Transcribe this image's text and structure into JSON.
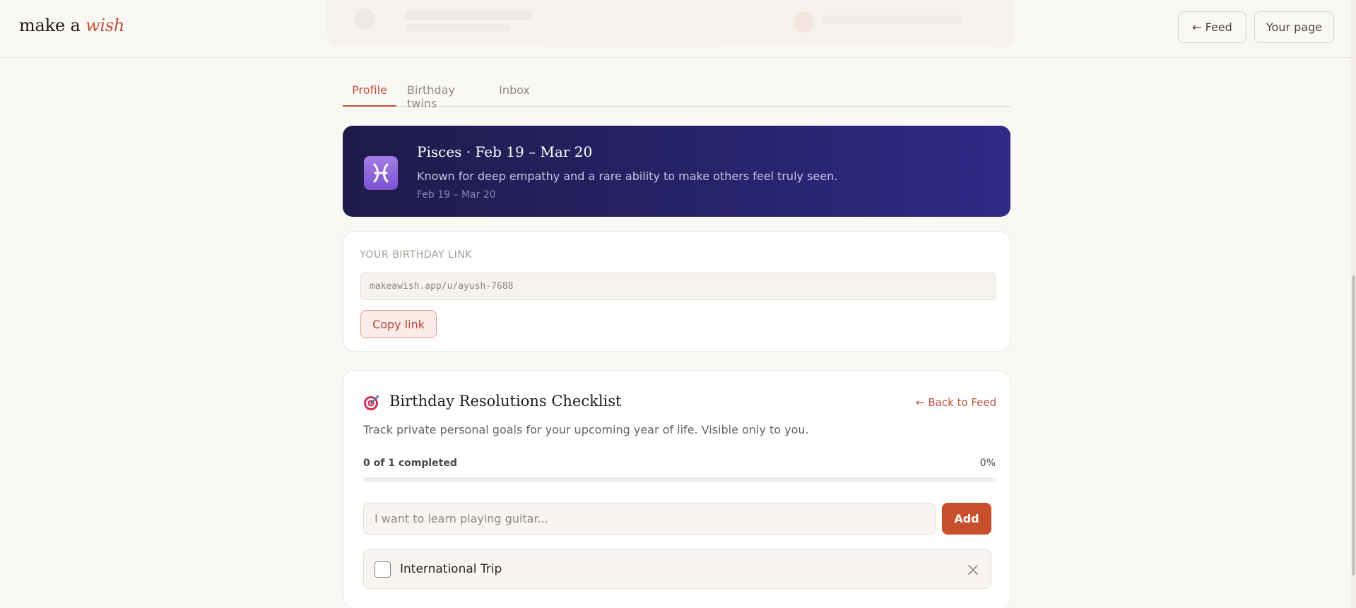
{
  "header": {
    "logo_main": "make a ",
    "logo_accent": "wish",
    "feed_button": "← Feed",
    "your_page_button": "Your page"
  },
  "tabs": [
    {
      "label": "Profile",
      "active": true
    },
    {
      "label": "Birthday twins",
      "active": false
    },
    {
      "label": "Inbox",
      "active": false
    }
  ],
  "zodiac": {
    "icon": "pisces-icon",
    "title": "Pisces · Feb 19 – Mar 20",
    "description": "Known for deep empathy and a rare ability to make others feel truly seen.",
    "range": "Feb 19 – Mar 20"
  },
  "birthday_link": {
    "label": "YOUR BIRTHDAY LINK",
    "url": "makeawish.app/u/ayush-7688",
    "copy_button": "Copy link"
  },
  "checklist": {
    "icon": "target-icon",
    "title": "Birthday Resolutions Checklist",
    "back_link": "← Back to Feed",
    "description": "Track private personal goals for your upcoming year of life. Visible only to you.",
    "progress_text": "0 of 1 completed",
    "progress_percent": "0%",
    "progress_fraction": 0,
    "input_placeholder": "I want to learn playing guitar...",
    "input_value": "",
    "add_button": "Add",
    "items": [
      {
        "label": "International Trip",
        "checked": false
      }
    ]
  },
  "colors": {
    "accent": "#c0533a",
    "button": "#c94f2c",
    "banner_start": "#1f1b4a",
    "banner_end": "#302a86",
    "background": "#faf8f5"
  }
}
